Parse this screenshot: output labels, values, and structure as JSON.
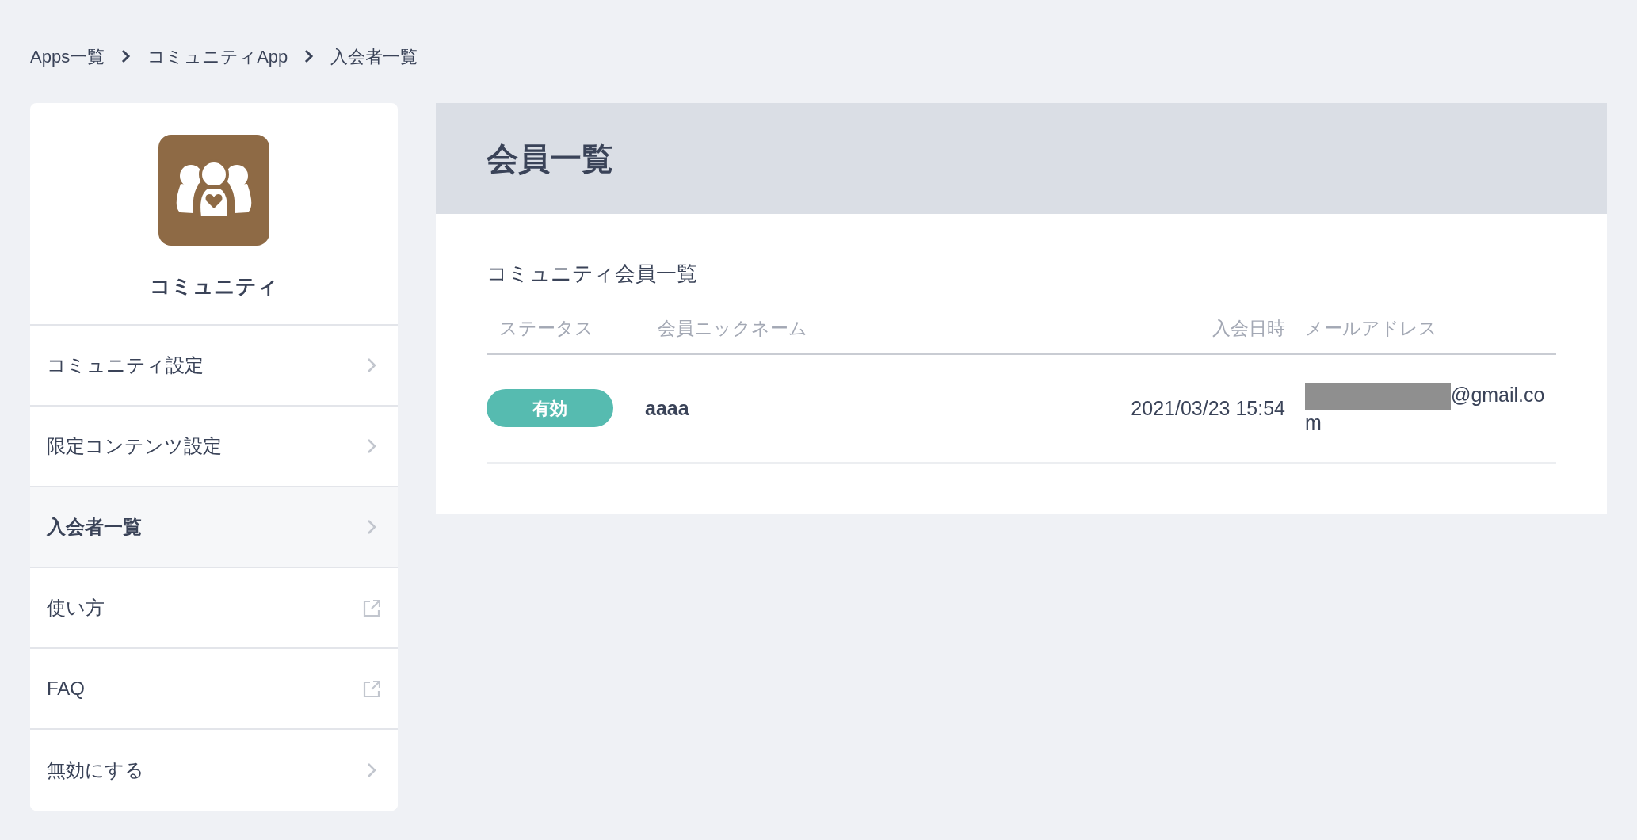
{
  "breadcrumb": [
    {
      "label": "Apps一覧"
    },
    {
      "label": "コミュニティApp"
    },
    {
      "label": "入会者一覧"
    }
  ],
  "sidebar": {
    "app_name": "コミュニティ",
    "items": [
      {
        "label": "コミュニティ設定",
        "kind": "chevron",
        "selected": false
      },
      {
        "label": "限定コンテンツ設定",
        "kind": "chevron",
        "selected": false
      },
      {
        "label": "入会者一覧",
        "kind": "chevron",
        "selected": true
      },
      {
        "label": "使い方",
        "kind": "external",
        "selected": false
      },
      {
        "label": "FAQ",
        "kind": "external",
        "selected": false
      },
      {
        "label": "無効にする",
        "kind": "chevron",
        "selected": false
      }
    ]
  },
  "main": {
    "title": "会員一覧",
    "section_title": "コミュニティ会員一覧",
    "table": {
      "columns": [
        "ステータス",
        "会員ニックネーム",
        "入会日時",
        "メールアドレス"
      ],
      "rows": [
        {
          "status": "有効",
          "status_active": true,
          "nickname": "aaaa",
          "joined": "2021/03/23 15:54",
          "email": "@gmail.com",
          "email_redacted": true
        }
      ]
    }
  }
}
